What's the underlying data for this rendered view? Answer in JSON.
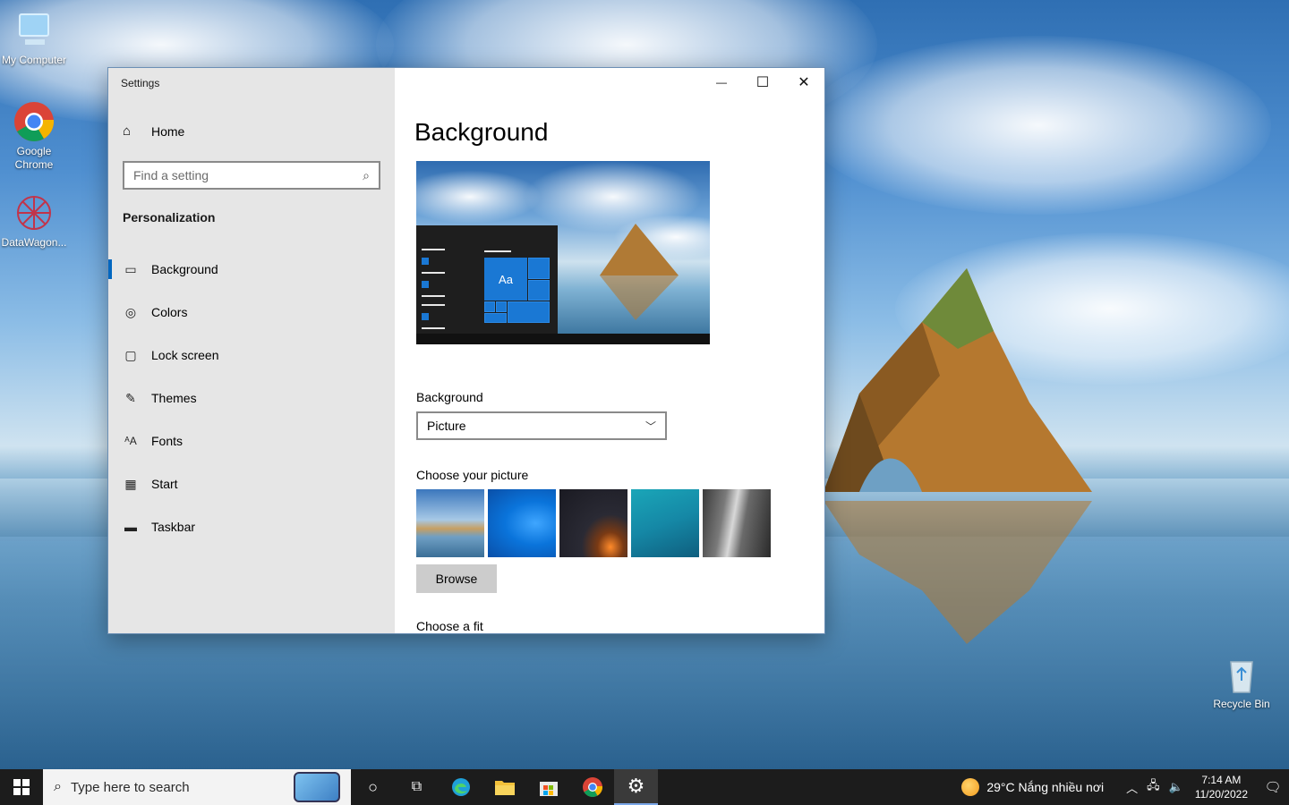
{
  "desktop": {
    "icons": [
      {
        "label": "My Computer"
      },
      {
        "label": "Google Chrome"
      },
      {
        "label": "DataWagon..."
      },
      {
        "label": "Recycle Bin"
      }
    ]
  },
  "window": {
    "title": "Settings",
    "controls": {
      "minimize": "—",
      "maximize": "☐",
      "close": "✕"
    }
  },
  "sidebar": {
    "home_label": "Home",
    "search_placeholder": "Find a setting",
    "section": "Personalization",
    "items": [
      {
        "label": "Background",
        "icon": "picture-icon",
        "active": true
      },
      {
        "label": "Colors",
        "icon": "palette-icon"
      },
      {
        "label": "Lock screen",
        "icon": "lock-screen-icon"
      },
      {
        "label": "Themes",
        "icon": "themes-icon"
      },
      {
        "label": "Fonts",
        "icon": "fonts-icon"
      },
      {
        "label": "Start",
        "icon": "start-icon"
      },
      {
        "label": "Taskbar",
        "icon": "taskbar-icon"
      }
    ]
  },
  "main": {
    "title": "Background",
    "preview_tile_text": "Aa",
    "background_label": "Background",
    "background_value": "Picture",
    "choose_picture_label": "Choose your picture",
    "browse_label": "Browse",
    "choose_fit_label": "Choose a fit"
  },
  "taskbar": {
    "search_placeholder": "Type here to search",
    "weather": "29°C  Nắng nhiều nơi",
    "time": "7:14 AM",
    "date": "11/20/2022"
  }
}
